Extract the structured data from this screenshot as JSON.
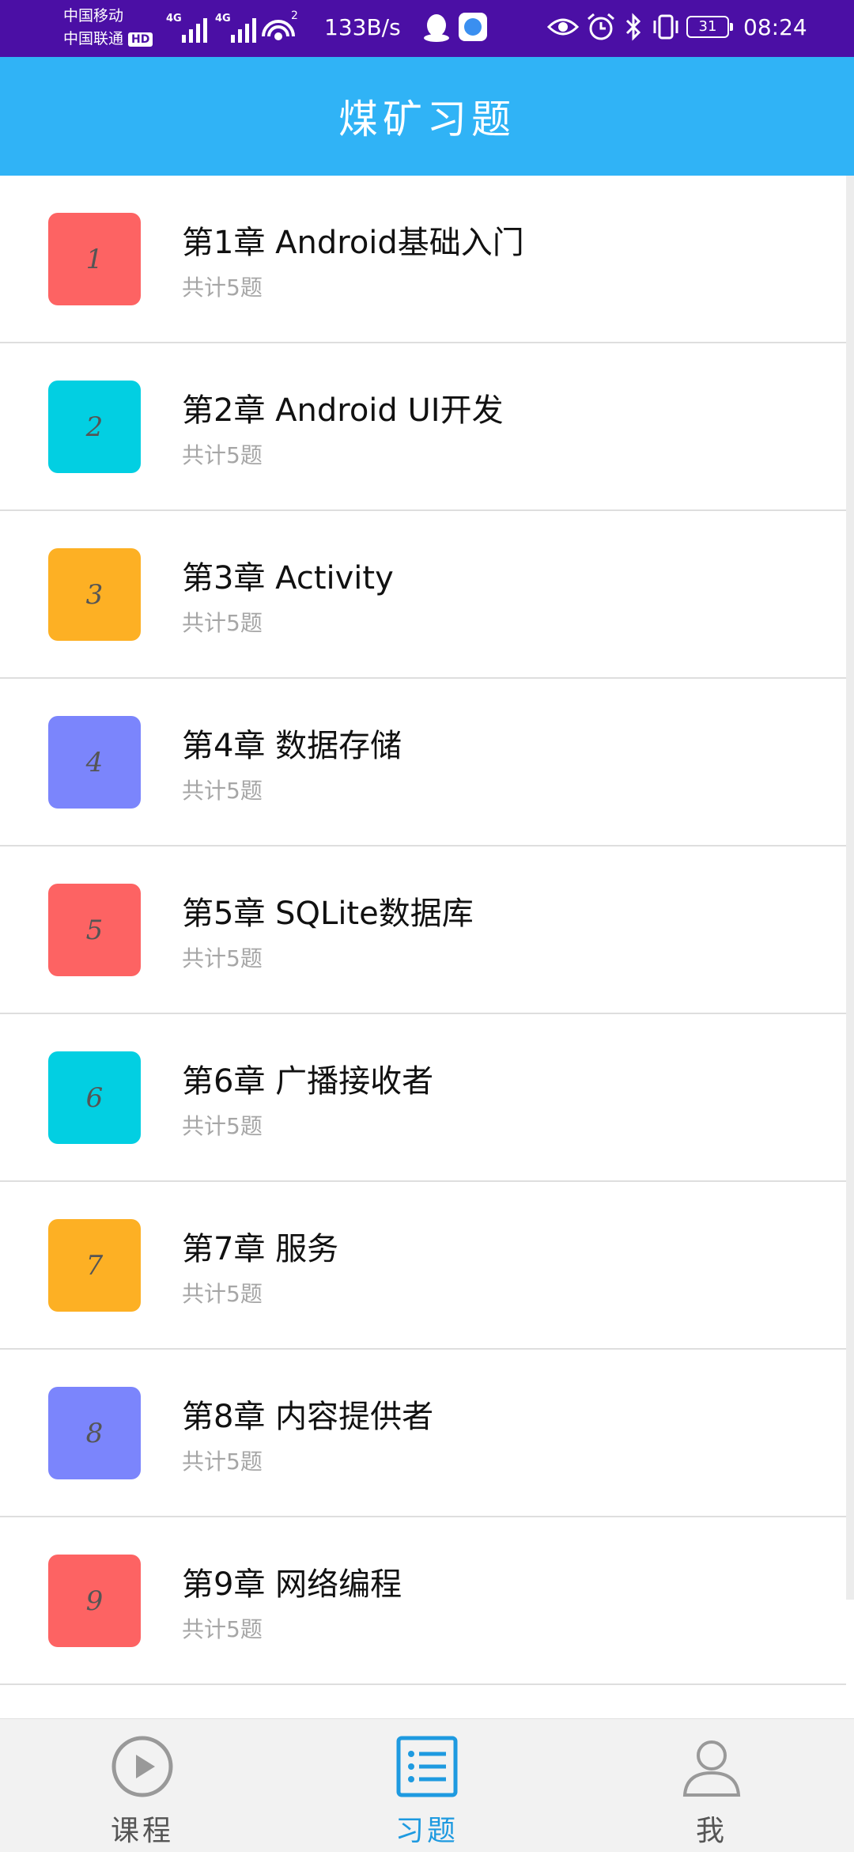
{
  "status_bar": {
    "carrier_1": "中国移动",
    "carrier_2": "中国联通",
    "hd_badge": "HD",
    "network_1": "4G",
    "network_2": "4G",
    "hotspot_badge": "2",
    "speed": "133B/s",
    "battery": "31",
    "time": "08:24"
  },
  "header": {
    "title": "煤矿习题"
  },
  "chapters": [
    {
      "badge": "1",
      "title": "第1章 Android基础入门",
      "subtitle": "共计5题",
      "color": "#fd6363"
    },
    {
      "badge": "2",
      "title": "第2章 Android UI开发",
      "subtitle": "共计5题",
      "color": "#02cfe2"
    },
    {
      "badge": "3",
      "title": "第3章 Activity",
      "subtitle": "共计5题",
      "color": "#fdb024"
    },
    {
      "badge": "4",
      "title": "第4章 数据存储",
      "subtitle": "共计5题",
      "color": "#7b85fc"
    },
    {
      "badge": "5",
      "title": "第5章 SQLite数据库",
      "subtitle": "共计5题",
      "color": "#fd6363"
    },
    {
      "badge": "6",
      "title": "第6章 广播接收者",
      "subtitle": "共计5题",
      "color": "#02cfe2"
    },
    {
      "badge": "7",
      "title": "第7章 服务",
      "subtitle": "共计5题",
      "color": "#fdb024"
    },
    {
      "badge": "8",
      "title": "第8章 内容提供者",
      "subtitle": "共计5题",
      "color": "#7b85fc"
    },
    {
      "badge": "9",
      "title": "第9章 网络编程",
      "subtitle": "共计5题",
      "color": "#fd6363"
    }
  ],
  "bottom_nav": {
    "items": [
      {
        "label": "课程",
        "icon": "play-circle-icon",
        "active": false
      },
      {
        "label": "习题",
        "icon": "list-icon",
        "active": true
      },
      {
        "label": "我",
        "icon": "person-icon",
        "active": false
      }
    ],
    "active_color": "#1e9ae0",
    "inactive_color": "#555555"
  }
}
